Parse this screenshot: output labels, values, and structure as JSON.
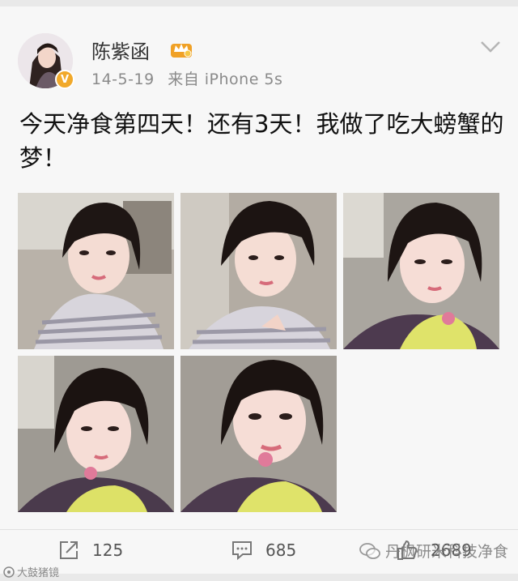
{
  "post": {
    "username": "陈紫函",
    "date": "14-5-19",
    "source": "来自 iPhone 5s",
    "text": "今天净食第四天！还有3天！我做了吃大螃蟹的梦！"
  },
  "photos": [
    {
      "label": "photo-1"
    },
    {
      "label": "photo-2"
    },
    {
      "label": "photo-3"
    },
    {
      "label": "photo-4"
    },
    {
      "label": "photo-5"
    }
  ],
  "actions": {
    "repost_count": "125",
    "comment_count": "685",
    "like_count": "2689"
  },
  "watermarks": {
    "right": "丹枫研米科技净食",
    "left": "大鼓猪镜"
  },
  "colors": {
    "verified_badge": "#f1a92b",
    "card_bg": "#f7f7f7",
    "page_bg": "#e9e9e9"
  },
  "icons": {
    "repost": "repost-icon",
    "comment": "comment-icon",
    "like": "like-icon",
    "menu": "chevron-down-icon",
    "verified": "verified-v-icon",
    "member": "crown-badge-icon",
    "wechat": "wechat-icon"
  }
}
